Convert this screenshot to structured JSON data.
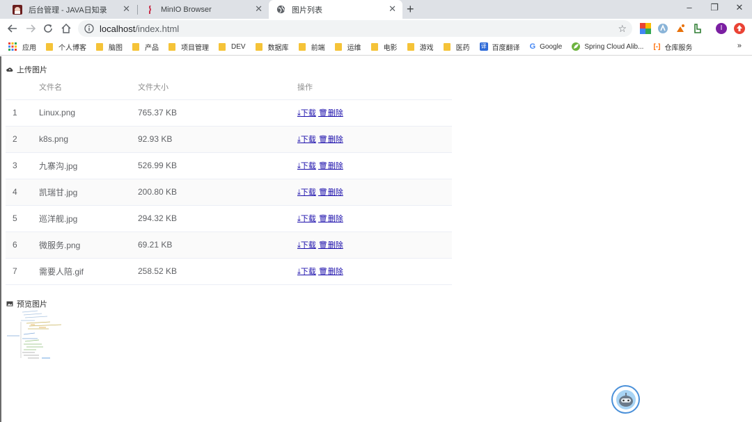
{
  "browser": {
    "tabs": [
      {
        "title": "后台管理 - JAVA日知录",
        "active": false
      },
      {
        "title": "MinIO Browser",
        "active": false
      },
      {
        "title": "图片列表",
        "active": true
      }
    ],
    "new_tab": "+",
    "window_controls": {
      "minimize": "–",
      "restore": "❐",
      "close": "✕"
    },
    "address": {
      "host": "localhost",
      "path": "/index.html"
    },
    "bookmarks": [
      {
        "label": "应用",
        "type": "apps"
      },
      {
        "label": "个人博客",
        "type": "folder"
      },
      {
        "label": "脑图",
        "type": "folder"
      },
      {
        "label": "产品",
        "type": "folder"
      },
      {
        "label": "项目管理",
        "type": "folder"
      },
      {
        "label": "DEV",
        "type": "folder"
      },
      {
        "label": "数据库",
        "type": "folder"
      },
      {
        "label": "前端",
        "type": "folder"
      },
      {
        "label": "运维",
        "type": "folder"
      },
      {
        "label": "电影",
        "type": "folder"
      },
      {
        "label": "游戏",
        "type": "folder"
      },
      {
        "label": "医药",
        "type": "folder"
      },
      {
        "label": "百度翻译",
        "type": "translate"
      },
      {
        "label": "Google",
        "type": "google"
      },
      {
        "label": "Spring Cloud Alib...",
        "type": "spring"
      },
      {
        "label": "仓库服务",
        "type": "aliyun"
      }
    ],
    "bookmarks_more": "»",
    "profile_initial": "I"
  },
  "upload": {
    "title": "上传图片",
    "columns": {
      "index": "",
      "name": "文件名",
      "size": "文件大小",
      "ops": "操作"
    },
    "download_label": "下载",
    "delete_label": "删除",
    "files": [
      {
        "index": "1",
        "name": "Linux.png",
        "size": "765.37 KB"
      },
      {
        "index": "2",
        "name": "k8s.png",
        "size": "92.93 KB"
      },
      {
        "index": "3",
        "name": "九寨沟.jpg",
        "size": "526.99 KB"
      },
      {
        "index": "4",
        "name": "凯瑞甘.jpg",
        "size": "200.80 KB"
      },
      {
        "index": "5",
        "name": "巡洋舰.jpg",
        "size": "294.32 KB"
      },
      {
        "index": "6",
        "name": "微服务.png",
        "size": "69.21 KB"
      },
      {
        "index": "7",
        "name": "需要人陪.gif",
        "size": "258.52 KB"
      }
    ]
  },
  "preview": {
    "title": "预览图片"
  },
  "colors": {
    "accent": "#1a0dab",
    "folder": "#f5c338",
    "chrome": "#dee1e6"
  }
}
